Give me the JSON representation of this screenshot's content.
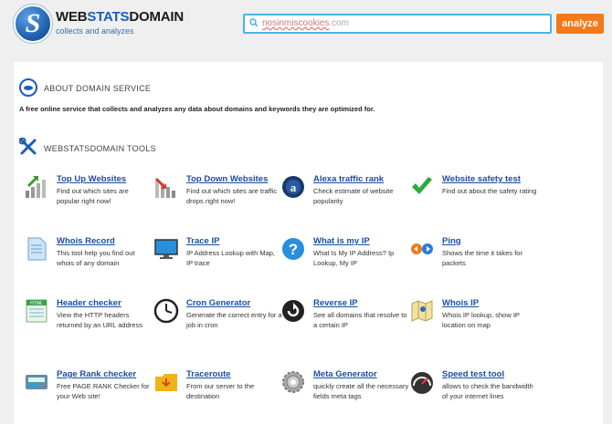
{
  "logo": {
    "letter": "S",
    "title_a": "WEB",
    "title_b": "STATS",
    "title_c": "DOMAIN",
    "subtitle": "collects and analyzes"
  },
  "search": {
    "value_a": "nosinmiscookies",
    "value_b": ".com",
    "button_label": "analyze"
  },
  "about": {
    "title": "ABOUT DOMAIN SERVICE",
    "text": "A free online service that collects and analyzes any data about domains and keywords they are optimized for."
  },
  "tools_section": {
    "title": "WEBSTATSDOMAIN TOOLS"
  },
  "tools": [
    {
      "name": "Top Up Websites",
      "desc": "Find out which sites are popular right now!",
      "icon": "chart-up-icon"
    },
    {
      "name": "Top Down Websites",
      "desc": "Find out which sites are traffic drops right now!",
      "icon": "chart-down-icon"
    },
    {
      "name": "Alexa traffic rank",
      "desc": "Check estimate of website popularity",
      "icon": "alexa-icon"
    },
    {
      "name": "Website safety test",
      "desc": "Find out about the safety rating",
      "icon": "checkmark-icon"
    },
    {
      "name": "Whois Record",
      "desc": "This tool help you find out whois of any domain",
      "icon": "document-icon"
    },
    {
      "name": "Trace IP",
      "desc": "IP Address Lookup with Map, IP trace",
      "icon": "monitor-icon"
    },
    {
      "name": "What is my IP",
      "desc": "What Is My IP Address? Ip Lookup, My IP",
      "icon": "question-icon"
    },
    {
      "name": "Ping",
      "desc": "Shows the time it takes for packets",
      "icon": "arrows-icon"
    },
    {
      "name": "Header checker",
      "desc": "View the HTTP headers returned by an URL address",
      "icon": "html-icon"
    },
    {
      "name": "Cron Generator",
      "desc": "Generate the correct entry for a job in cron",
      "icon": "clock-icon"
    },
    {
      "name": "Reverse IP",
      "desc": "See all domains that resolve to a certain IP",
      "icon": "reverse-icon"
    },
    {
      "name": "Whois IP",
      "desc": "Whois IP lookup, show IP location on map",
      "icon": "map-icon"
    },
    {
      "name": "Page Rank checker",
      "desc": "Free PAGE RANK Checker for your Web site!",
      "icon": "pagerank-icon"
    },
    {
      "name": "Traceroute",
      "desc": "From our server to the destination",
      "icon": "folder-icon"
    },
    {
      "name": "Meta Generator",
      "desc": "quickly create all the necessary fields meta tags",
      "icon": "gear-icon"
    },
    {
      "name": "Speed test tool",
      "desc": "allows to check the bandwidth of your internet lines",
      "icon": "speedometer-icon"
    }
  ]
}
